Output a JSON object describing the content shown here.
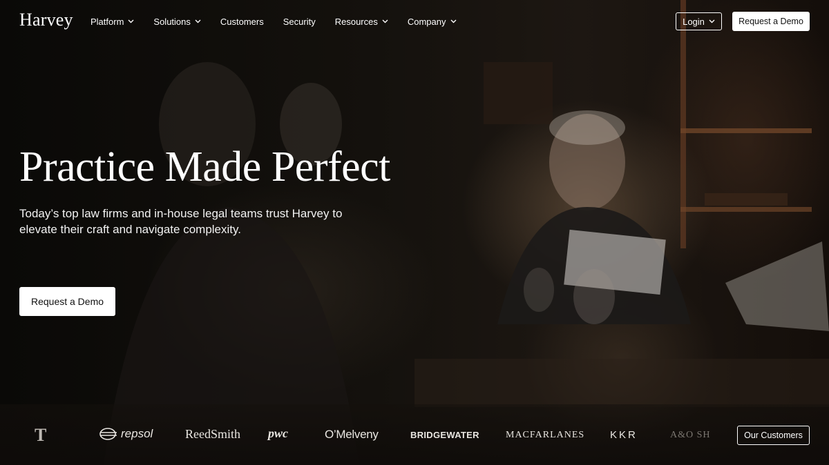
{
  "nav": {
    "logo": "Harvey",
    "links": [
      {
        "label": "Platform",
        "dropdown": true
      },
      {
        "label": "Solutions",
        "dropdown": true
      },
      {
        "label": "Customers",
        "dropdown": false
      },
      {
        "label": "Security",
        "dropdown": false
      },
      {
        "label": "Resources",
        "dropdown": true
      },
      {
        "label": "Company",
        "dropdown": true
      }
    ],
    "login_label": "Login",
    "demo_label": "Request a Demo"
  },
  "hero": {
    "title": "Practice Made Perfect",
    "subtitle": "Today’s top law firms and in-house legal teams trust Harvey to elevate their craft and navigate complexity.",
    "cta_label": "Request a Demo"
  },
  "customers": {
    "logos": [
      "T",
      "repsol",
      "ReedSmith",
      "pwc",
      "O’Melveny",
      "BRIDGEWATER",
      "MACFARLANES",
      "KKR",
      "A&O SH"
    ],
    "button_label": "Our Customers"
  },
  "colors": {
    "background": "#0b0907",
    "text": "#ffffff",
    "button_bg": "#ffffff",
    "button_text": "#111111"
  }
}
